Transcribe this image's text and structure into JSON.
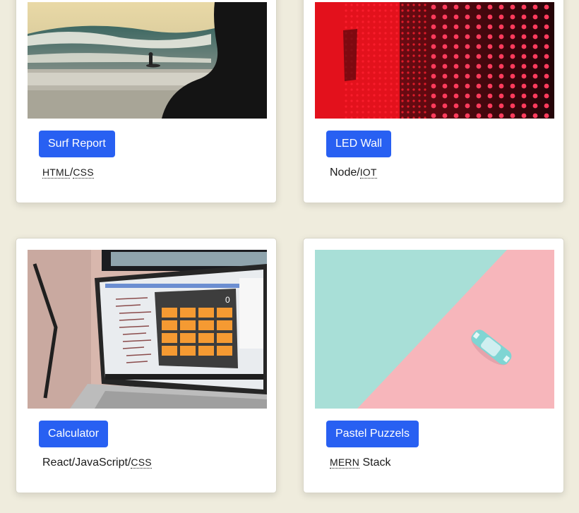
{
  "projects": [
    {
      "title": "Surf Report",
      "tech_parts": [
        {
          "text": "HTML",
          "abbr": true
        },
        {
          "text": "/",
          "abbr": false
        },
        {
          "text": "CSS",
          "abbr": true
        }
      ]
    },
    {
      "title": "LED Wall",
      "tech_parts": [
        {
          "text": "Node/",
          "abbr": false
        },
        {
          "text": "IOT",
          "abbr": true
        }
      ]
    },
    {
      "title": "Calculator",
      "tech_parts": [
        {
          "text": "React/JavaScript/",
          "abbr": false
        },
        {
          "text": "CSS",
          "abbr": true
        }
      ]
    },
    {
      "title": "Pastel Puzzels",
      "tech_parts": [
        {
          "text": "MERN",
          "abbr": true
        },
        {
          "text": " Stack",
          "abbr": false
        }
      ]
    }
  ],
  "calculator_display": "0",
  "colors": {
    "background": "#efecdd",
    "button": "#2860f2",
    "card": "#ffffff"
  }
}
